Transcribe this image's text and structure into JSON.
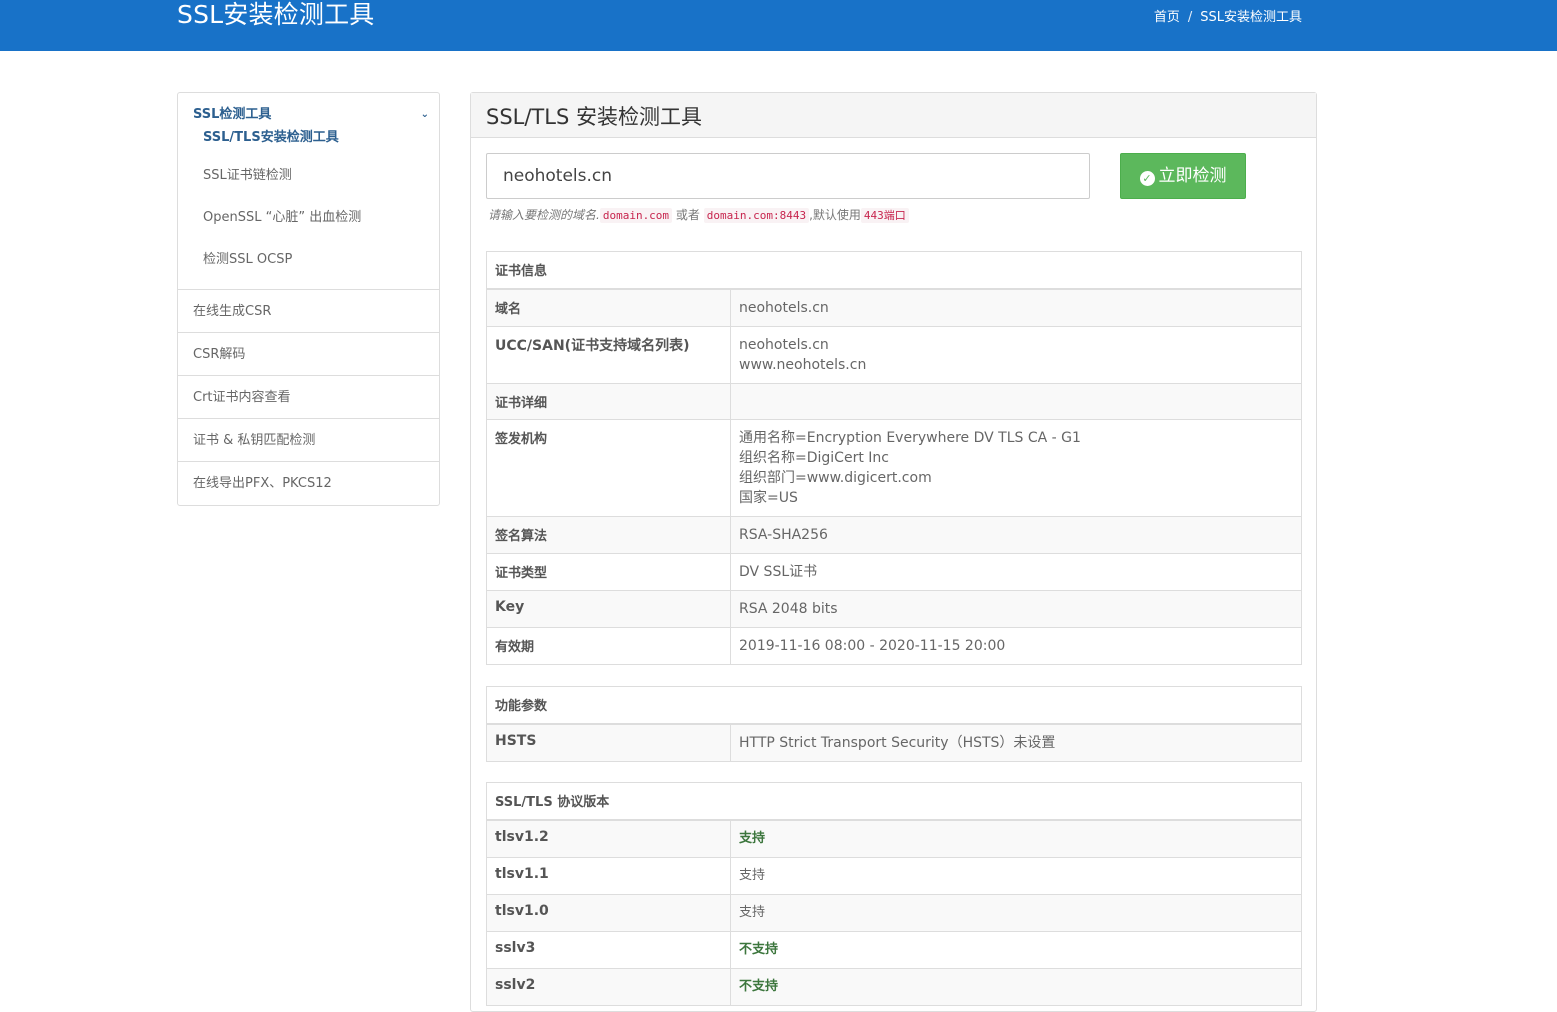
{
  "header": {
    "title": "SSL安装检测工具",
    "breadcrumb_home": "首页",
    "breadcrumb_sep": "/",
    "breadcrumb_current": "SSL安装检测工具"
  },
  "sidebar": {
    "group_title": "SSL检测工具",
    "sub_items": [
      "SSL/TLS安装检测工具",
      "SSL证书链检测",
      "OpenSSL “心脏” 出血检测",
      "检测SSL OCSP"
    ],
    "items": [
      "在线生成CSR",
      "CSR解码",
      "Crt证书内容查看",
      "证书 & 私钥匹配检测",
      "在线导出PFX、PKCS12"
    ]
  },
  "panel": {
    "title": "SSL/TLS 安装检测工具",
    "input_value": "neohotels.cn",
    "button_label": "立即检测",
    "hint": {
      "prefix": "请输入要检测的域名.",
      "code1": "domain.com",
      "mid": "或者",
      "code2": "domain.com:8443",
      "suffix": ",默认使用",
      "code3": "443端口"
    }
  },
  "cert_table": {
    "caption": "证书信息",
    "rows": [
      {
        "k": "域名",
        "v": [
          "neohotels.cn"
        ]
      },
      {
        "k": "UCC/SAN(证书支持域名列表)",
        "v": [
          "neohotels.cn",
          "www.neohotels.cn"
        ]
      },
      {
        "k": "证书详细",
        "v": [
          ""
        ]
      },
      {
        "k": "签发机构",
        "v": [
          "通用名称=Encryption Everywhere DV TLS CA - G1",
          "组织名称=DigiCert Inc",
          "组织部门=www.digicert.com",
          "国家=US"
        ]
      },
      {
        "k": "签名算法",
        "v": [
          "RSA-SHA256"
        ]
      },
      {
        "k": "证书类型",
        "v": [
          "DV SSL证书"
        ]
      },
      {
        "k": "Key",
        "v": [
          "RSA 2048 bits"
        ]
      },
      {
        "k": "有效期",
        "v": [
          "2019-11-16 08:00 - 2020-11-15 20:00"
        ]
      }
    ]
  },
  "feature_table": {
    "caption": "功能参数",
    "rows": [
      {
        "k": "HSTS",
        "v": "HTTP Strict Transport Security（HSTS）未设置"
      }
    ]
  },
  "protocol_table": {
    "caption": "SSL/TLS 协议版本",
    "rows": [
      {
        "k": "tlsv1.2",
        "v": "支持",
        "green": true
      },
      {
        "k": "tlsv1.1",
        "v": "支持",
        "green": false
      },
      {
        "k": "tlsv1.0",
        "v": "支持",
        "green": false
      },
      {
        "k": "sslv3",
        "v": "不支持",
        "green": true
      },
      {
        "k": "sslv2",
        "v": "不支持",
        "green": true
      }
    ]
  },
  "colors": {
    "topbar": "#1872c8",
    "button": "#5cb85c",
    "sidebar_active": "#2c5f8f",
    "ok_green": "#3c763d"
  }
}
